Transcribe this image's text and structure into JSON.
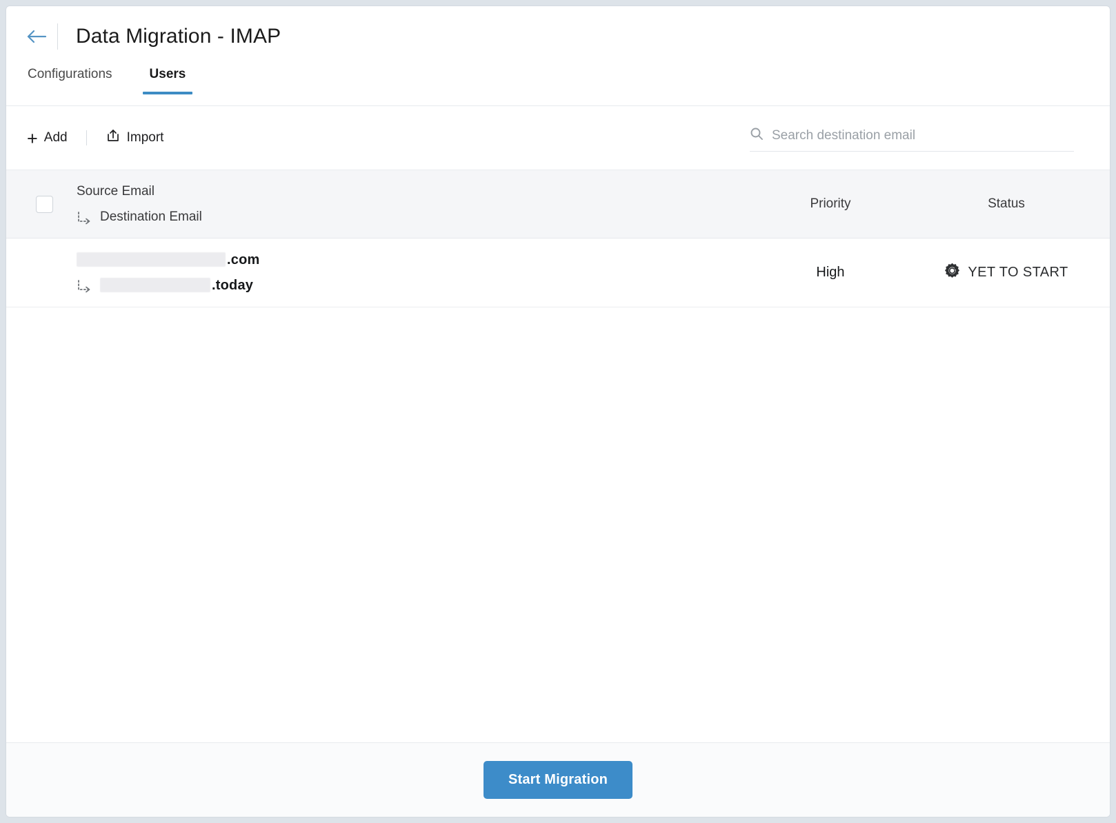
{
  "header": {
    "title": "Data Migration - IMAP",
    "back_icon": "arrow-left-icon",
    "accent_color": "#3d8cc4"
  },
  "tabs": [
    {
      "label": "Configurations",
      "active": false
    },
    {
      "label": "Users",
      "active": true
    }
  ],
  "toolbar": {
    "add_label": "Add",
    "add_icon": "plus-icon",
    "import_label": "Import",
    "import_icon": "upload-icon"
  },
  "search": {
    "placeholder": "Search destination email",
    "value": "",
    "icon": "search-icon"
  },
  "table": {
    "columns": {
      "source_email": "Source Email",
      "destination_email": "Destination Email",
      "priority": "Priority",
      "status": "Status"
    },
    "rows": [
      {
        "source_email_suffix": ".com",
        "destination_email_suffix": ".today",
        "priority": "High",
        "status": "YET TO START",
        "status_icon": "gear-icon"
      }
    ]
  },
  "footer": {
    "start_migration_label": "Start Migration",
    "button_color": "#3d8cc9"
  }
}
